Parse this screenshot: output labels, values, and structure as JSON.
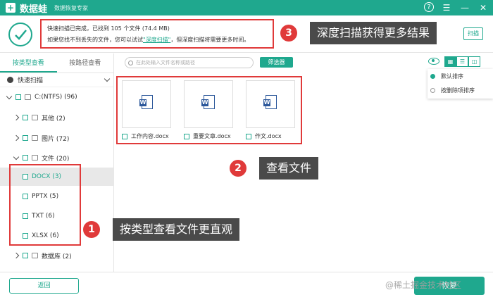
{
  "titlebar": {
    "logo": "+",
    "app_name": "数据蛙",
    "subtitle": "数据恢复专家",
    "help": "?",
    "menu": "☰",
    "minimize": "—",
    "close": "✕"
  },
  "status": {
    "line1": "快速扫描已完成，已找到 105 个文件 (74.4 MB)",
    "line2_before": "如果您找不到丢失的文件，您可以试试",
    "line2_link": "\"深度扫描\"",
    "line2_after": "，但深度扫描将需要更多时间。",
    "top_right_button": "扫描"
  },
  "sidebar": {
    "tabs": [
      "按类型查看",
      "按路径查看"
    ],
    "scan_mode": "快速扫描",
    "tree": [
      {
        "label": "C:(NTFS) (96)"
      },
      {
        "label": "其他 (2)"
      },
      {
        "label": "图片 (72)"
      },
      {
        "label": "文件 (20)"
      },
      {
        "label": "DOCX (3)"
      },
      {
        "label": "PPTX (5)"
      },
      {
        "label": "TXT (6)"
      },
      {
        "label": "XLSX (6)"
      },
      {
        "label": "数据库 (2)"
      }
    ]
  },
  "toolbar": {
    "search_placeholder": "在此处输入文件名称或路径",
    "filter_label": "筛选器"
  },
  "view": {
    "grid": "▦",
    "list": "☰",
    "detail": "◫"
  },
  "sort_menu": [
    "默认排序",
    "按删除项排序"
  ],
  "files": [
    {
      "name": "工作内容.docx",
      "icon": "W"
    },
    {
      "name": "重要文章.docx",
      "icon": "W"
    },
    {
      "name": "作文.docx",
      "icon": "W"
    }
  ],
  "annotations": [
    {
      "number": "1",
      "text": "按类型查看文件更直观"
    },
    {
      "number": "2",
      "text": "查看文件"
    },
    {
      "number": "3",
      "text": "深度扫描获得更多结果"
    }
  ],
  "bottom": {
    "back": "返回",
    "recover": "恢复"
  },
  "watermark": "@稀土掘金技术社区",
  "colors": {
    "accent": "#1fa88e",
    "annotation": "#e03a3a",
    "callout_bg": "#4a4a4a"
  }
}
